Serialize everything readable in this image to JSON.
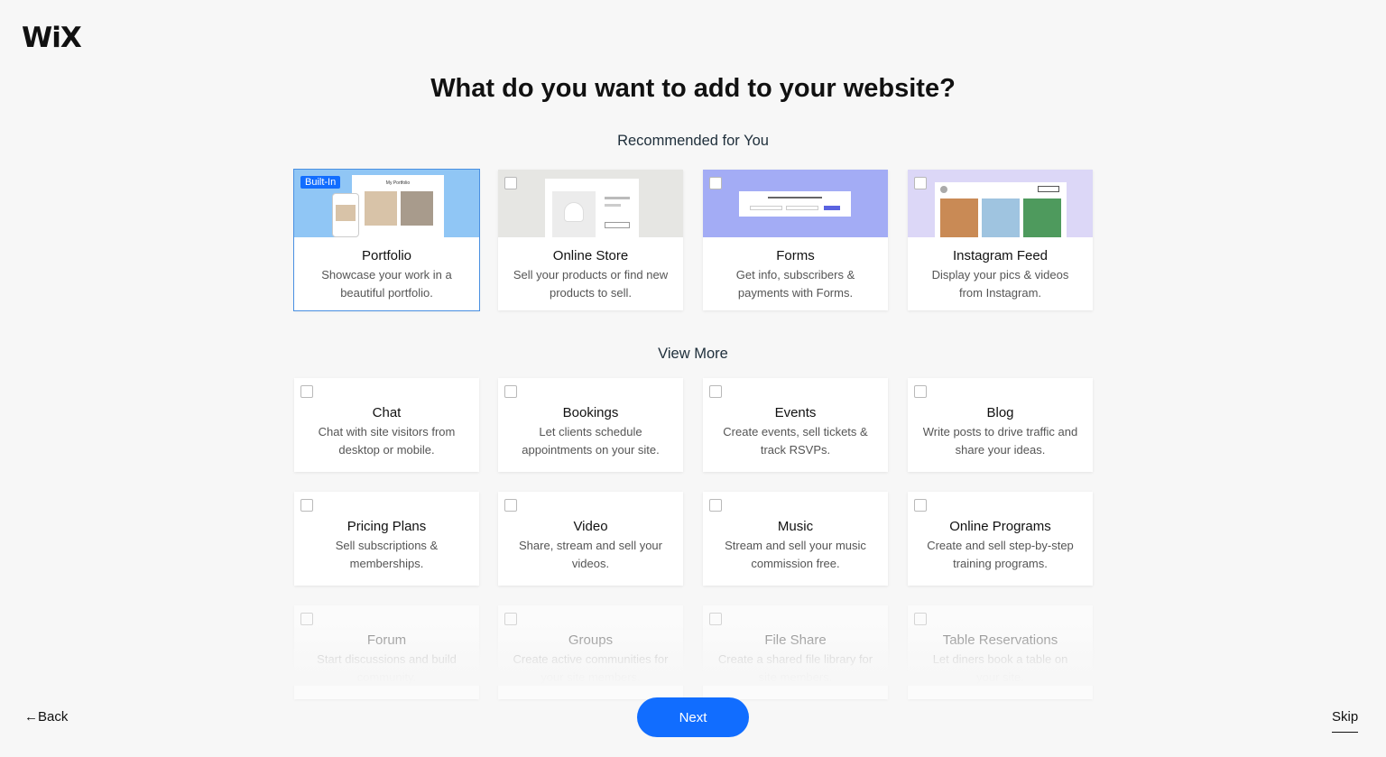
{
  "brand": {
    "logo": "WiX"
  },
  "page": {
    "title": "What do you want to add to your website?"
  },
  "recommended": {
    "heading": "Recommended for You",
    "cards": [
      {
        "title": "Portfolio",
        "desc": "Showcase your work in a beautiful portfolio.",
        "badge": "Built-In",
        "selected": true,
        "thumb_title": "My Portfolio"
      },
      {
        "title": "Online Store",
        "desc": "Sell your products or find new products to sell.",
        "selected": false
      },
      {
        "title": "Forms",
        "desc": "Get info, subscribers & payments with Forms.",
        "selected": false
      },
      {
        "title": "Instagram Feed",
        "desc": "Display your pics & videos from Instagram.",
        "selected": false
      }
    ]
  },
  "more": {
    "heading": "View More",
    "cards": [
      {
        "title": "Chat",
        "desc": "Chat with site visitors from desktop or mobile."
      },
      {
        "title": "Bookings",
        "desc": "Let clients schedule appointments on your site."
      },
      {
        "title": "Events",
        "desc": "Create events, sell tickets & track RSVPs."
      },
      {
        "title": "Blog",
        "desc": "Write posts to drive traffic and share your ideas."
      },
      {
        "title": "Pricing Plans",
        "desc": "Sell subscriptions & memberships."
      },
      {
        "title": "Video",
        "desc": "Share, stream and sell your videos."
      },
      {
        "title": "Music",
        "desc": "Stream and sell your music commission free."
      },
      {
        "title": "Online Programs",
        "desc": "Create and sell step-by-step training programs."
      },
      {
        "title": "Forum",
        "desc": "Start discussions and build community."
      },
      {
        "title": "Groups",
        "desc": "Create active communities for your site members."
      },
      {
        "title": "File Share",
        "desc": "Create a shared file library for site members."
      },
      {
        "title": "Table Reservations",
        "desc": "Let diners book a table on your site."
      }
    ]
  },
  "footer": {
    "back": "←Back",
    "next": "Next",
    "skip": "Skip"
  },
  "colors": {
    "accent": "#116dff",
    "background": "#f7f7f7"
  }
}
